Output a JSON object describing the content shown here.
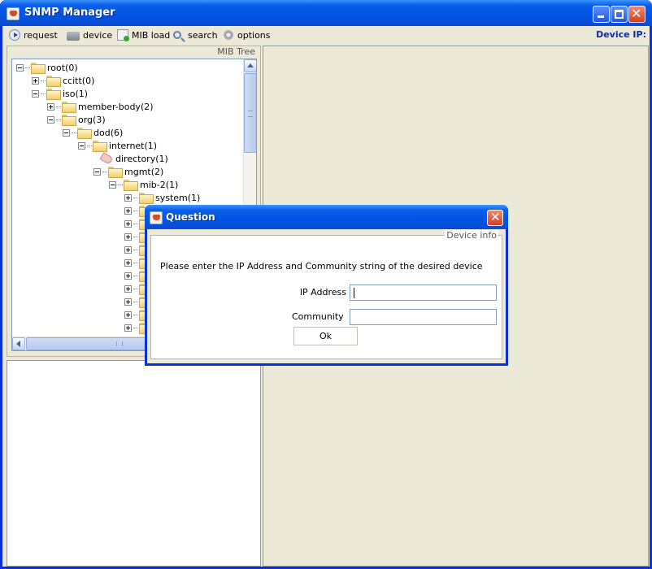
{
  "window": {
    "title": "SNMP Manager"
  },
  "menubar": {
    "items": [
      {
        "label": "request",
        "icon": "play-circle-icon"
      },
      {
        "label": "device",
        "icon": "device-icon"
      },
      {
        "label": "MIB load",
        "icon": "mib-load-icon"
      },
      {
        "label": "search",
        "icon": "magnifier-icon"
      },
      {
        "label": "options",
        "icon": "gear-icon"
      }
    ],
    "device_ip_label": "Device IP:"
  },
  "mib_tree": {
    "legend": "MIB Tree",
    "nodes": [
      {
        "label": "root(0)",
        "depth": 0,
        "expander": "minus",
        "icon": "folder"
      },
      {
        "label": "ccitt(0)",
        "depth": 1,
        "expander": "plus",
        "icon": "folder"
      },
      {
        "label": "iso(1)",
        "depth": 1,
        "expander": "minus",
        "icon": "folder"
      },
      {
        "label": "member-body(2)",
        "depth": 2,
        "expander": "plus",
        "icon": "folder"
      },
      {
        "label": "org(3)",
        "depth": 2,
        "expander": "minus",
        "icon": "folder"
      },
      {
        "label": "dod(6)",
        "depth": 3,
        "expander": "minus",
        "icon": "folder"
      },
      {
        "label": "internet(1)",
        "depth": 4,
        "expander": "minus",
        "icon": "folder"
      },
      {
        "label": "directory(1)",
        "depth": 5,
        "expander": "none",
        "icon": "tag"
      },
      {
        "label": "mgmt(2)",
        "depth": 5,
        "expander": "minus",
        "icon": "folder"
      },
      {
        "label": "mib-2(1)",
        "depth": 6,
        "expander": "minus",
        "icon": "folder"
      },
      {
        "label": "system(1)",
        "depth": 7,
        "expander": "plus",
        "icon": "folder"
      },
      {
        "label": "",
        "depth": 7,
        "expander": "plus",
        "icon": "folder"
      },
      {
        "label": "",
        "depth": 7,
        "expander": "plus",
        "icon": "folder"
      },
      {
        "label": "",
        "depth": 7,
        "expander": "plus",
        "icon": "folder"
      },
      {
        "label": "",
        "depth": 7,
        "expander": "plus",
        "icon": "folder"
      },
      {
        "label": "",
        "depth": 7,
        "expander": "plus",
        "icon": "folder"
      },
      {
        "label": "",
        "depth": 7,
        "expander": "plus",
        "icon": "folder"
      },
      {
        "label": "",
        "depth": 7,
        "expander": "plus",
        "icon": "folder"
      },
      {
        "label": "",
        "depth": 7,
        "expander": "plus",
        "icon": "folder"
      },
      {
        "label": "",
        "depth": 7,
        "expander": "plus",
        "icon": "folder"
      },
      {
        "label": "",
        "depth": 7,
        "expander": "plus",
        "icon": "folder"
      }
    ]
  },
  "dialog": {
    "title": "Question",
    "group_legend": "Device info",
    "prompt": "Please enter the IP Address and Community string of the desired device",
    "ip_label": "IP Address",
    "ip_value": "",
    "community_label": "Community",
    "community_value": "",
    "ok_label": "Ok"
  }
}
